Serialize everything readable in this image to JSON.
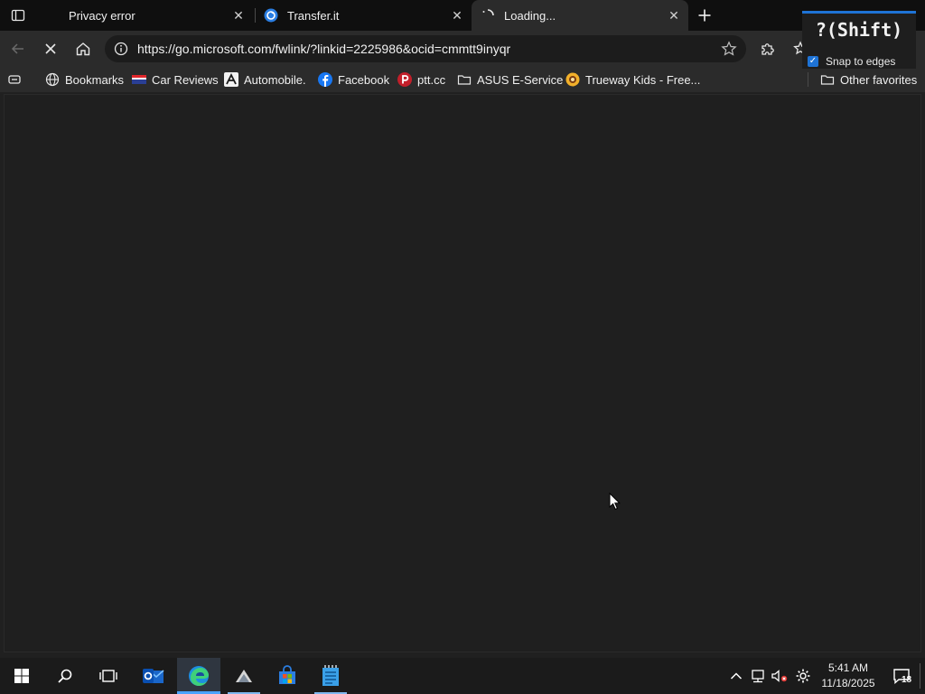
{
  "tabs": [
    {
      "title": "Privacy error",
      "favicon": "privacy-error-icon",
      "active": false
    },
    {
      "title": "Transfer.it",
      "favicon": "transfer-it-icon",
      "active": false
    },
    {
      "title": "Loading...",
      "favicon": "loading-spinner-icon",
      "active": true
    }
  ],
  "toolbar": {
    "url": "https://go.microsoft.com/fwlink/?linkid=2225986&ocid=cmmtt9inyqr"
  },
  "bookmarks": [
    {
      "label": "Bookmarks",
      "icon": "globe-icon"
    },
    {
      "label": "Car Reviews",
      "icon": "car-reviews-flag-icon"
    },
    {
      "label": "Automobile.",
      "icon": "automobile-logo-icon"
    },
    {
      "label": "Facebook",
      "icon": "facebook-icon"
    },
    {
      "label": "ptt.cc",
      "icon": "ptt-icon"
    },
    {
      "label": "ASUS E-Service",
      "icon": "folder-icon"
    },
    {
      "label": "Trueway Kids - Free...",
      "icon": "trueway-kids-icon"
    },
    {
      "label": "Other favorites",
      "icon": "folder-icon"
    }
  ],
  "overlay": {
    "shortcut": "?(Shift)",
    "snap_label": "Snap to edges",
    "snap_checked": true
  },
  "taskbar": {
    "time": "5:41 AM",
    "date": "11/18/2025",
    "notification_count": "18",
    "apps": [
      "start-icon",
      "search-icon",
      "task-view-icon",
      "outlook-icon",
      "edge-icon",
      "app-icon",
      "store-icon",
      "notepad-icon"
    ]
  },
  "colors": {
    "accent": "#1e73d6",
    "background": "#202020",
    "tabstrip": "#0f0f0f",
    "toolbar": "#2b2b2b"
  }
}
